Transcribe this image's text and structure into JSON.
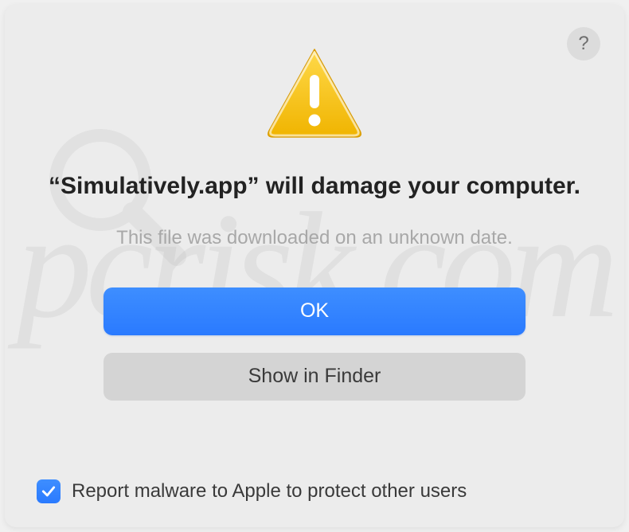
{
  "help_label": "?",
  "title_prefix": "“",
  "title_appname": "Simulatively.app",
  "title_suffix": "” will damage your computer.",
  "subtitle": "This file was downloaded on an unknown date.",
  "buttons": {
    "ok": "OK",
    "show_in_finder": "Show in Finder"
  },
  "checkbox": {
    "checked": true,
    "label": "Report malware to Apple to protect other users"
  },
  "watermark_text": "pcrisk.com"
}
